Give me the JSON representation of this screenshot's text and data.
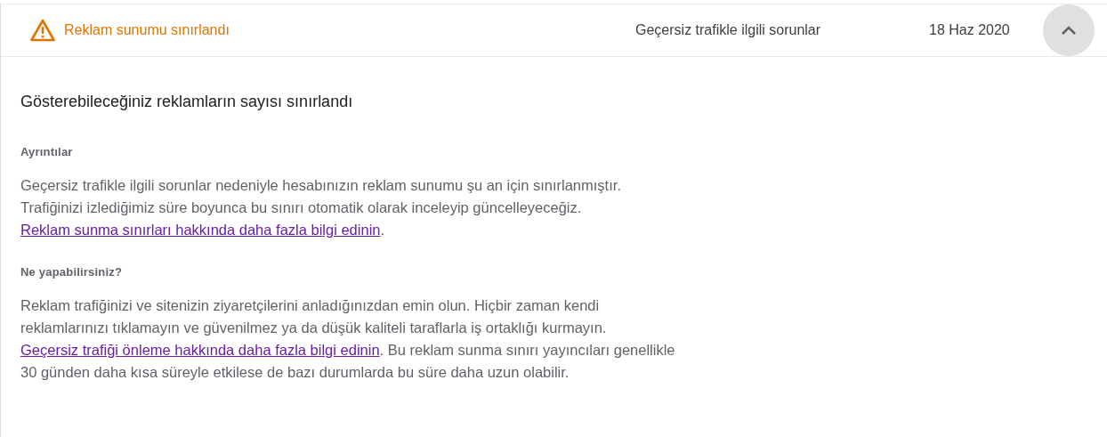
{
  "header": {
    "status": "Reklam sunumu sınırlandı",
    "category": "Geçersiz trafikle ilgili sorunlar",
    "date": "18 Haz 2020",
    "expanded": true
  },
  "title": "Gösterebileceğiniz reklamların sayısı sınırlandı",
  "sections": [
    {
      "heading": "Ayrıntılar",
      "text_before": "Geçersiz trafikle ilgili sorunlar nedeniyle hesabınızın reklam sunumu şu an için sınırlanmıştır. Trafiğinizi izlediğimiz süre boyunca bu sınırı otomatik olarak inceleyip güncelleyeceğiz. ",
      "link": "Reklam sunma sınırları hakkında daha fazla bilgi edinin",
      "text_after": "."
    },
    {
      "heading": "Ne yapabilirsiniz?",
      "text_before": "Reklam trafiğinizi ve sitenizin ziyaretçilerini anladığınızdan emin olun. Hiçbir zaman kendi reklamlarınızı tıklamayın ve güvenilmez ya da düşük kaliteli taraflarla iş ortaklığı kurmayın. ",
      "link": "Geçersiz trafiği önleme hakkında daha fazla bilgi edinin",
      "text_after": ". Bu reklam sunma sınırı yayıncıları genellikle 30 günden daha kısa süreyle etkilese de bazı durumlarda bu süre daha uzun olabilir."
    }
  ]
}
